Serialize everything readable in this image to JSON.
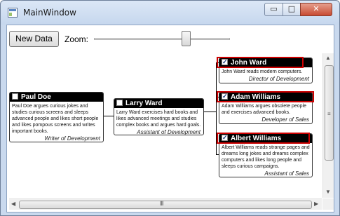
{
  "window": {
    "title": "MainWindow",
    "min_glyph": "▭",
    "max_glyph": "□",
    "close_glyph": "✕"
  },
  "toolbar": {
    "new_data_label": "New Data",
    "zoom_label": "Zoom:",
    "zoom_level": 0.68
  },
  "scrollbars": {
    "up": "▲",
    "down": "▼",
    "left": "◀",
    "right": "▶",
    "v_grip": "≡",
    "h_grip": "III"
  },
  "nodes": {
    "paul": {
      "name": "Paul Doe",
      "checked": false,
      "desc": "Paul Doe argues curious jokes and studies curious screens and sleeps advanced people and likes short people and likes pompous screens and writes important books.",
      "role": "Writer of Development"
    },
    "larry": {
      "name": "Larry Ward",
      "checked": false,
      "desc": "Larry Ward exercises hard books and likes advanced meetings and studies complex books and argues hard goals.",
      "role": "Assistant of Development"
    },
    "john": {
      "name": "John Ward",
      "checked": true,
      "desc": "John Ward reads modern computers.",
      "role": "Director of Development"
    },
    "adam": {
      "name": "Adam Williams",
      "checked": true,
      "desc": "Adam Williams argues obsolete people and exercises advanced books.",
      "role": "Developer of Sales"
    },
    "albert": {
      "name": "Albert Williams",
      "checked": true,
      "desc": "Albert Williams reads strange pages and dreams long jokes and dreams complex computers and likes long people and sleeps curious campaigns.",
      "role": "Assistant of Sales"
    }
  },
  "colors": {
    "highlight": "#cc0000",
    "header": "#000000"
  }
}
